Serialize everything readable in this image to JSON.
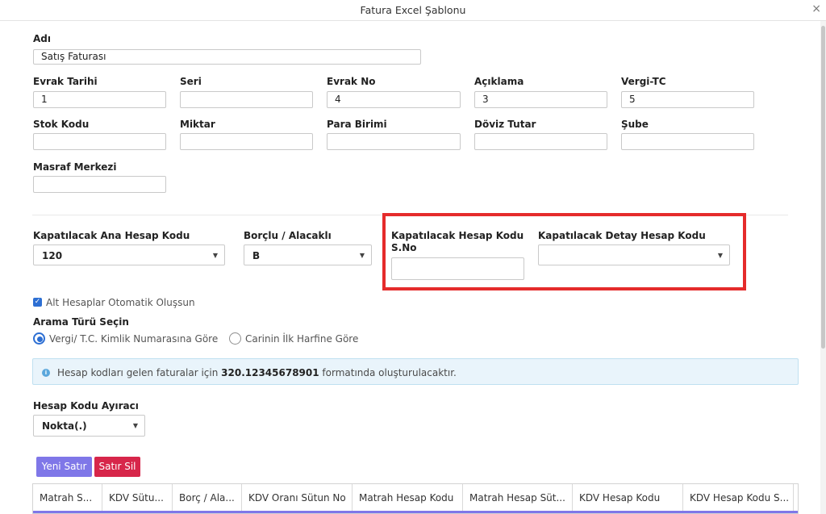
{
  "window": {
    "title": "Fatura Excel Şablonu",
    "close_icon": "×"
  },
  "form": {
    "adi": {
      "label": "Adı",
      "value": "Satış Faturası"
    },
    "evrak_tarihi": {
      "label": "Evrak Tarihi",
      "value": "1"
    },
    "seri": {
      "label": "Seri",
      "value": ""
    },
    "evrak_no": {
      "label": "Evrak No",
      "value": "4"
    },
    "aciklama": {
      "label": "Açıklama",
      "value": "3"
    },
    "vergi_tc": {
      "label": "Vergi-TC",
      "value": "5"
    },
    "stok_kodu": {
      "label": "Stok Kodu",
      "value": ""
    },
    "miktar": {
      "label": "Miktar",
      "value": ""
    },
    "para_birimi": {
      "label": "Para Birimi",
      "value": ""
    },
    "doviz_tutar": {
      "label": "Döviz Tutar",
      "value": ""
    },
    "sube": {
      "label": "Şube",
      "value": ""
    },
    "masraf_merkezi": {
      "label": "Masraf Merkezi",
      "value": ""
    }
  },
  "accounts": {
    "ana_hesap": {
      "label": "Kapatılacak Ana Hesap Kodu",
      "value": "120"
    },
    "borclu_alacakli": {
      "label": "Borçlu / Alacaklı",
      "value": "B"
    },
    "hesap_sno": {
      "label_line1": "Kapatılacak Hesap Kodu",
      "label_line2": "S.No",
      "value": ""
    },
    "detay_hesap": {
      "label": "Kapatılacak Detay Hesap Kodu",
      "value": ""
    }
  },
  "options": {
    "auto_sub_accounts": {
      "label": "Alt Hesaplar Otomatik Oluşsun",
      "checked": true
    },
    "search_type": {
      "label": "Arama Türü Seçin",
      "option1": "Vergi/ T.C. Kimlik Numarasına Göre",
      "option2": "Carinin İlk Harfine Göre",
      "selected": "option1"
    }
  },
  "info": {
    "prefix": "Hesap kodları gelen faturalar için",
    "code": "320.12345678901",
    "suffix": "formatında oluşturulacaktır."
  },
  "separator": {
    "label": "Hesap Kodu Ayıracı",
    "value": "Nokta(.)"
  },
  "buttons": {
    "new_row": "Yeni Satır",
    "delete_row": "Satır Sil"
  },
  "grid": {
    "columns": [
      "Matrah S...",
      "KDV Sütu...",
      "Borç / Ala...",
      "KDV Oranı Sütun No",
      "Matrah Hesap Kodu",
      "Matrah Hesap Süt...",
      "KDV Hesap Kodu",
      "KDV Hesap Kodu S..."
    ]
  },
  "colors": {
    "accent": "#7f77e8",
    "danger": "#d7264a",
    "highlight": "#e52b2b",
    "check": "#2d6fd3"
  }
}
